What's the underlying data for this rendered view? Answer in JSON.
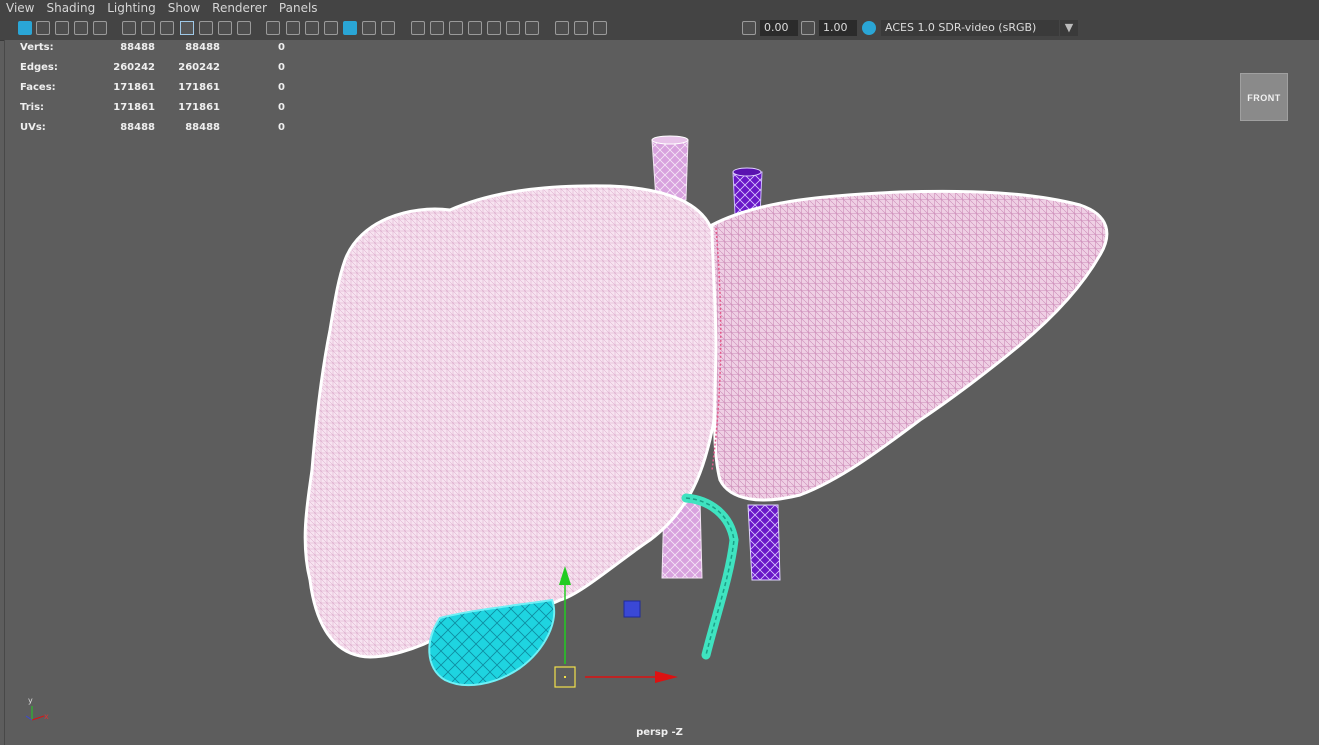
{
  "menu": [
    "View",
    "Shading",
    "Lighting",
    "Show",
    "Renderer",
    "Panels"
  ],
  "toolbar": {
    "icons": [
      "select-camera-icon",
      "frame-all-icon",
      "frame-selected-icon",
      "lock-camera-icon",
      "bookmark-icon",
      "image-plane-icon",
      "2d-pan-icon",
      "grease-pencil-icon",
      "grid-icon",
      "film-gate-icon",
      "resolution-gate-icon",
      "gate-mask-icon",
      "field-chart-icon",
      "safe-action-icon",
      "safe-title-icon",
      "wireframe-icon",
      "smooth-shade-icon",
      "wireframe-on-shaded-icon",
      "textured-icon",
      "use-lights-icon",
      "shadows-icon",
      "ambient-occlusion-icon",
      "motion-blur-icon",
      "anti-aliasing-icon",
      "depth-of-field-icon",
      "isolate-select-icon",
      "xray-icon",
      "xray-joints-icon",
      "backface-culling-icon",
      "exposure-icon",
      "gamma-icon",
      "color-management-icon"
    ],
    "exposure_value": "0.00",
    "gamma_value": "1.00",
    "color_space": "ACES 1.0 SDR-video (sRGB)"
  },
  "hud": {
    "rows": [
      {
        "label": "Verts:",
        "v1": "88488",
        "v2": "88488",
        "v3": "0"
      },
      {
        "label": "Edges:",
        "v1": "260242",
        "v2": "260242",
        "v3": "0"
      },
      {
        "label": "Faces:",
        "v1": "171861",
        "v2": "171861",
        "v3": "0"
      },
      {
        "label": "Tris:",
        "v1": "171861",
        "v2": "171861",
        "v3": "0"
      },
      {
        "label": "UVs:",
        "v1": "88488",
        "v2": "88488",
        "v3": "0"
      }
    ]
  },
  "viewcube_label": "FRONT",
  "camera_label": "persp -Z",
  "axis": {
    "y": "y",
    "x": "x"
  },
  "colors": {
    "liver": "#f4dbeb",
    "liver_wire": "#d79bc4",
    "gallbladder": "#1ed4e0",
    "vena_cava": "#6a18c8",
    "portal_vein": "#d8a2de",
    "bile_duct": "#3fe3c0",
    "manipulator_y": "#22cc22",
    "manipulator_x": "#dd1111"
  }
}
